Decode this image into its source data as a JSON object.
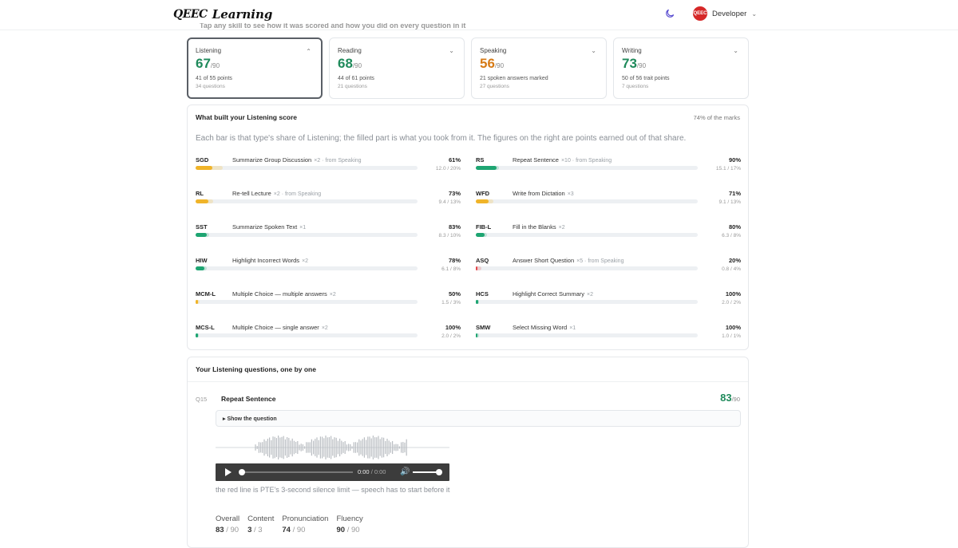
{
  "header": {
    "logo_mark": "QEEC",
    "logo_text": "Learning",
    "avatar_text": "QEEC",
    "user_name": "Developer"
  },
  "hint_top": "Tap any skill to see how it was scored and how you did on every question in it",
  "cards": [
    {
      "name": "Listening",
      "score": "67",
      "den": "/90",
      "points": "41 of 55 points",
      "questions": "34 questions",
      "color": "#1f8a5b",
      "active": true,
      "chevron": "^"
    },
    {
      "name": "Reading",
      "score": "68",
      "den": "/90",
      "points": "44 of 61 points",
      "questions": "21 questions",
      "color": "#1f8a5b",
      "active": false,
      "chevron": "v"
    },
    {
      "name": "Speaking",
      "score": "56",
      "den": "/90",
      "points": "21 spoken answers marked",
      "questions": "27 questions",
      "color": "#d67a16",
      "active": false,
      "chevron": "v"
    },
    {
      "name": "Writing",
      "score": "73",
      "den": "/90",
      "points": "50 of 56 trait points",
      "questions": "7 questions",
      "color": "#1f8a5b",
      "active": false,
      "chevron": "v"
    }
  ],
  "breakdown": {
    "title": "What built your Listening score",
    "right_note": "74% of the marks",
    "description": "Each bar is that type's share of Listening; the filled part is what you took from it. The figures on the right are points earned out of that share.",
    "rows": [
      {
        "code": "SGD",
        "name": "Summarize Group Discussion",
        "meta": "×2 · from Speaking",
        "pct": "61%",
        "pts": "12.0 / 20%",
        "share": 20,
        "score_pct": 61,
        "color": "#f0b429"
      },
      {
        "code": "RS",
        "name": "Repeat Sentence",
        "meta": "×10 · from Speaking",
        "pct": "90%",
        "pts": "15.1 / 17%",
        "share": 17,
        "score_pct": 90,
        "color": "#1ea672"
      },
      {
        "code": "RL",
        "name": "Re-tell Lecture",
        "meta": "×2 · from Speaking",
        "pct": "73%",
        "pts": "9.4 / 13%",
        "share": 13,
        "score_pct": 73,
        "color": "#f0b429"
      },
      {
        "code": "WFD",
        "name": "Write from Dictation",
        "meta": "×3",
        "pct": "71%",
        "pts": "9.1 / 13%",
        "share": 13,
        "score_pct": 71,
        "color": "#f0b429"
      },
      {
        "code": "SST",
        "name": "Summarize Spoken Text",
        "meta": "×1",
        "pct": "83%",
        "pts": "8.3 / 10%",
        "share": 10,
        "score_pct": 83,
        "color": "#1ea672"
      },
      {
        "code": "FIB-L",
        "name": "Fill in the Blanks",
        "meta": "×2",
        "pct": "80%",
        "pts": "6.3 / 8%",
        "share": 8,
        "score_pct": 80,
        "color": "#1ea672"
      },
      {
        "code": "HIW",
        "name": "Highlight Incorrect Words",
        "meta": "×2",
        "pct": "78%",
        "pts": "6.1 / 8%",
        "share": 8,
        "score_pct": 78,
        "color": "#1ea672"
      },
      {
        "code": "ASQ",
        "name": "Answer Short Question",
        "meta": "×5 · from Speaking",
        "pct": "20%",
        "pts": "0.8 / 4%",
        "share": 4,
        "score_pct": 20,
        "color": "#e5484d"
      },
      {
        "code": "MCM-L",
        "name": "Multiple Choice — multiple answers",
        "meta": "×2",
        "pct": "50%",
        "pts": "1.5 / 3%",
        "share": 3,
        "score_pct": 50,
        "color": "#f0b429"
      },
      {
        "code": "HCS",
        "name": "Highlight Correct Summary",
        "meta": "×2",
        "pct": "100%",
        "pts": "2.0 / 2%",
        "share": 2,
        "score_pct": 100,
        "color": "#1ea672"
      },
      {
        "code": "MCS-L",
        "name": "Multiple Choice — single answer",
        "meta": "×2",
        "pct": "100%",
        "pts": "2.0 / 2%",
        "share": 2,
        "score_pct": 100,
        "color": "#1ea672"
      },
      {
        "code": "SMW",
        "name": "Select Missing Word",
        "meta": "×1",
        "pct": "100%",
        "pts": "1.0 / 1%",
        "share": 1,
        "score_pct": 100,
        "color": "#1ea672"
      }
    ]
  },
  "questions": {
    "title": "Your Listening questions, one by one",
    "item": {
      "num": "Q15",
      "name": "Repeat Sentence",
      "score": "83",
      "den": "/90",
      "show_label": "▸ Show the question",
      "player": {
        "time": "0:00",
        "sep": " / ",
        "total": "0:00",
        "progress": 0,
        "volume": 1
      },
      "note": "the red line is PTE's 3-second silence limit — speech has to start before it",
      "metrics": [
        {
          "label": "Overall",
          "value": "83",
          "den": " / 90"
        },
        {
          "label": "Content",
          "value": "3",
          "den": " / 3"
        },
        {
          "label": "Pronunciation",
          "value": "74",
          "den": " / 90"
        },
        {
          "label": "Fluency",
          "value": "90",
          "den": " / 90"
        }
      ]
    }
  }
}
